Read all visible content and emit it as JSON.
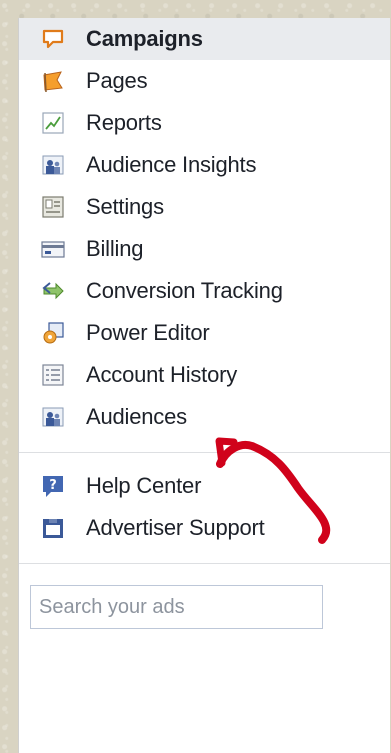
{
  "nav": {
    "items": [
      {
        "label": "Campaigns",
        "icon": "campaigns-icon",
        "active": true
      },
      {
        "label": "Pages",
        "icon": "pages-flag-icon"
      },
      {
        "label": "Reports",
        "icon": "reports-chart-icon"
      },
      {
        "label": "Audience Insights",
        "icon": "audience-insights-icon"
      },
      {
        "label": "Settings",
        "icon": "settings-icon"
      },
      {
        "label": "Billing",
        "icon": "billing-card-icon"
      },
      {
        "label": "Conversion Tracking",
        "icon": "conversion-tracking-icon"
      },
      {
        "label": "Power Editor",
        "icon": "power-editor-icon"
      },
      {
        "label": "Account History",
        "icon": "account-history-icon"
      },
      {
        "label": "Audiences",
        "icon": "audiences-icon"
      }
    ]
  },
  "support": {
    "items": [
      {
        "label": "Help Center",
        "icon": "help-question-icon"
      },
      {
        "label": "Advertiser Support",
        "icon": "advertiser-support-icon"
      }
    ]
  },
  "search": {
    "placeholder": "Search your ads",
    "value": ""
  },
  "colors": {
    "accent": "#3b5998",
    "active_bg": "#e9ebee",
    "annotation": "#d0021b",
    "text": "#1d2129"
  }
}
